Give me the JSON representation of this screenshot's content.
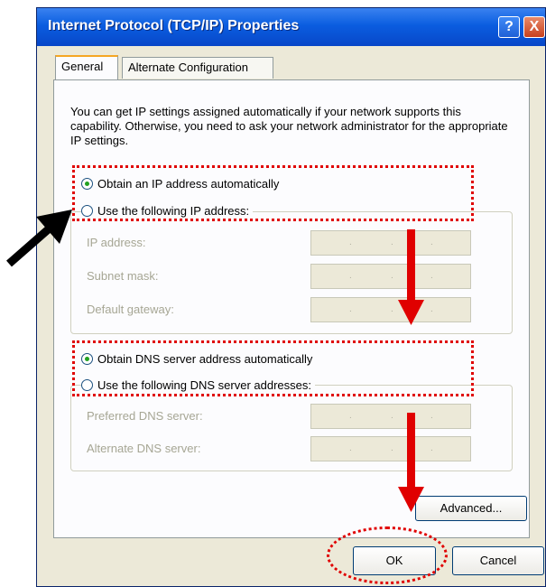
{
  "window": {
    "title": "Internet Protocol (TCP/IP) Properties"
  },
  "title_buttons": {
    "help": "?",
    "close": "X"
  },
  "tabs": [
    {
      "label": "General",
      "active": true
    },
    {
      "label": "Alternate Configuration",
      "active": false
    }
  ],
  "description": "You can get IP settings assigned automatically if your network supports this capability. Otherwise, you need to ask your network administrator for the appropriate IP settings.",
  "ip_section": {
    "auto_option": "Obtain an IP address automatically",
    "manual_option": "Use the following IP address:",
    "selected": "auto",
    "fields": [
      {
        "label": "IP address:",
        "value": ". . ."
      },
      {
        "label": "Subnet mask:",
        "value": ". . ."
      },
      {
        "label": "Default gateway:",
        "value": ". . ."
      }
    ]
  },
  "dns_section": {
    "auto_option": "Obtain DNS server address automatically",
    "manual_option": "Use the following DNS server addresses:",
    "selected": "auto",
    "fields": [
      {
        "label": "Preferred DNS server:",
        "value": ". . ."
      },
      {
        "label": "Alternate DNS server:",
        "value": ". . ."
      }
    ]
  },
  "buttons": {
    "advanced": "Advanced...",
    "ok": "OK",
    "cancel": "Cancel"
  },
  "annotation_color": "#e00000"
}
